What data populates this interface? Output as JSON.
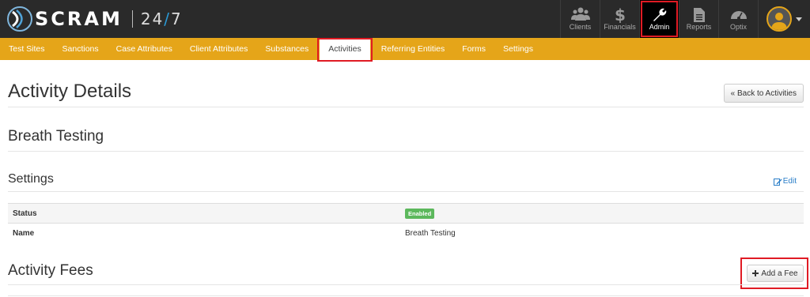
{
  "brand": {
    "name": "SCRAM",
    "num_left": "24",
    "slash": "/",
    "num_right": "7"
  },
  "topnav": [
    {
      "label": "Clients",
      "icon": "users-icon"
    },
    {
      "label": "Financials",
      "icon": "dollar-icon"
    },
    {
      "label": "Admin",
      "icon": "wrench-icon",
      "selected": true
    },
    {
      "label": "Reports",
      "icon": "document-icon"
    },
    {
      "label": "Optix",
      "icon": "dashboard-icon"
    }
  ],
  "subnav": [
    {
      "label": "Test Sites"
    },
    {
      "label": "Sanctions"
    },
    {
      "label": "Case Attributes"
    },
    {
      "label": "Client Attributes"
    },
    {
      "label": "Substances"
    },
    {
      "label": "Activities",
      "active": true
    },
    {
      "label": "Referring Entities"
    },
    {
      "label": "Forms"
    },
    {
      "label": "Settings"
    }
  ],
  "page": {
    "title": "Activity Details",
    "back_button": "« Back to Activities",
    "activity_name": "Breath Testing",
    "settings_heading": "Settings",
    "edit_label": "Edit",
    "settings_rows": [
      {
        "key": "Status",
        "value": "Enabled"
      },
      {
        "key": "Name",
        "value": "Breath Testing"
      }
    ],
    "fees_heading": "Activity Fees",
    "add_fee_button": "Add a Fee"
  },
  "colors": {
    "accent": "#e5a519",
    "topbar": "#2a2a2a",
    "highlight": "#e01b24",
    "link": "#2a7ec8",
    "badge": "#5cb85c"
  }
}
